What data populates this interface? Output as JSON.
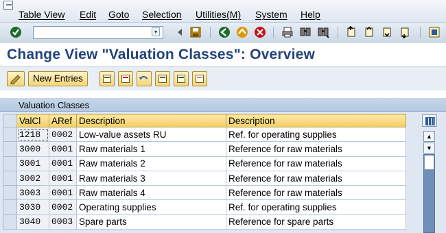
{
  "menu": {
    "items": [
      "Table View",
      "Edit",
      "Goto",
      "Selection",
      "Utilities(M)",
      "System",
      "Help"
    ]
  },
  "toolbar": {
    "command_value": "",
    "icons": [
      "enter-icon",
      "back-nav-icon",
      "save-icon",
      "back-icon",
      "exit-icon",
      "cancel-icon",
      "print-icon",
      "find-icon",
      "find-next-icon",
      "first-page-icon",
      "prev-page-icon",
      "next-page-icon",
      "last-page-icon",
      "customize-layout-icon"
    ]
  },
  "title": "Change View \"Valuation Classes\": Overview",
  "app_toolbar": {
    "new_entries": "New Entries",
    "icons": [
      "change-display-icon",
      "copy-as-icon",
      "delete-icon",
      "undo-change-icon",
      "select-all-icon",
      "select-block-icon",
      "deselect-all-icon"
    ]
  },
  "table": {
    "title": "Valuation Classes",
    "columns": [
      "ValCl",
      "ARef",
      "Description",
      "Description"
    ],
    "rows": [
      {
        "valcl": "1218",
        "aref": "0002",
        "desc1": "Low-value assets RU",
        "desc2": "Ref. for operating supplies"
      },
      {
        "valcl": "3000",
        "aref": "0001",
        "desc1": "Raw materials 1",
        "desc2": "Reference for raw materials"
      },
      {
        "valcl": "3001",
        "aref": "0001",
        "desc1": "Raw materials 2",
        "desc2": "Reference for raw materials"
      },
      {
        "valcl": "3002",
        "aref": "0001",
        "desc1": "Raw materials 3",
        "desc2": "Reference for raw materials"
      },
      {
        "valcl": "3003",
        "aref": "0001",
        "desc1": "Raw materials 4",
        "desc2": "Reference for raw materials"
      },
      {
        "valcl": "3030",
        "aref": "0002",
        "desc1": "Operating supplies",
        "desc2": "Ref. for operating supplies"
      },
      {
        "valcl": "3040",
        "aref": "0003",
        "desc1": "Spare parts",
        "desc2": "Reference for spare parts"
      }
    ]
  },
  "scrollbar": {
    "up_glyph": "▲",
    "down_glyph": "▼"
  },
  "colors": {
    "title": "#23437a",
    "header_bg": "#f2cf63",
    "panel_bg": "#dfe8f2",
    "scroll_track": "#6d8fba"
  }
}
